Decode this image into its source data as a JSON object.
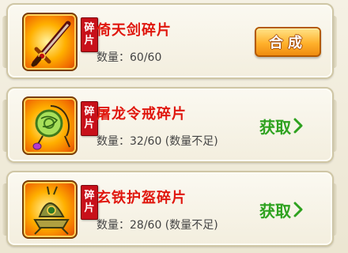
{
  "fragment_tag": "碎片",
  "items": [
    {
      "title": "倚天剑碎片",
      "quantity": "数量：60/60",
      "action_label": "合成",
      "action_type": "compose",
      "icon": "sword-icon"
    },
    {
      "title": "屠龙令戒碎片",
      "quantity": "数量：32/60 (数量不足)",
      "action_label": "获取",
      "action_type": "obtain",
      "icon": "jade-ring-icon"
    },
    {
      "title": "玄铁护盔碎片",
      "quantity": "数量：28/60 (数量不足)",
      "action_label": "获取",
      "action_type": "obtain",
      "icon": "helmet-icon"
    }
  ],
  "colors": {
    "title": "#e0170e",
    "obtain": "#2ea11f",
    "compose": "#ffb12c",
    "tag": "#c8101a"
  }
}
